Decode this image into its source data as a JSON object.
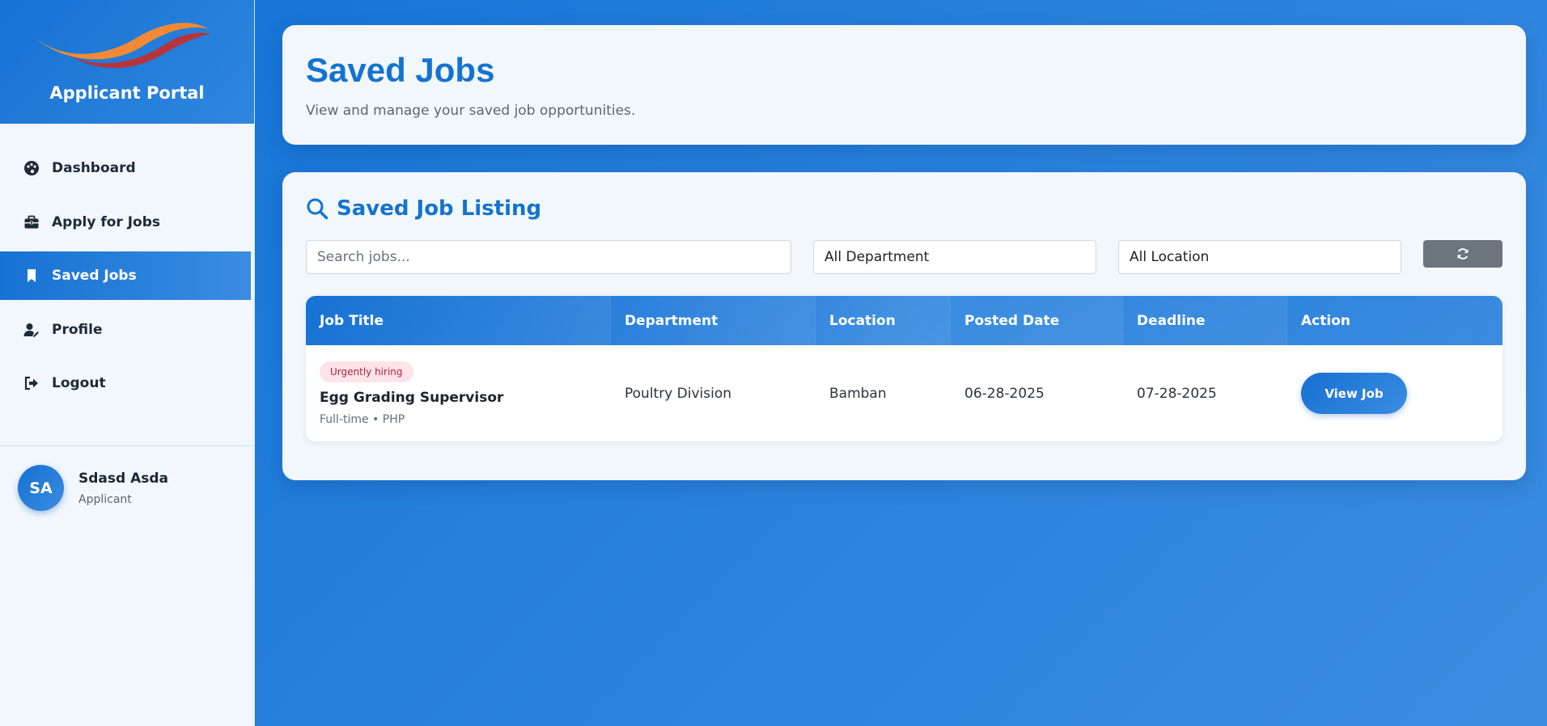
{
  "sidebar": {
    "portal_title": "Applicant Portal",
    "items": [
      {
        "label": "Dashboard",
        "icon": "palette-icon",
        "active": false
      },
      {
        "label": "Apply for Jobs",
        "icon": "briefcase-icon",
        "active": false
      },
      {
        "label": "Saved Jobs",
        "icon": "bookmark-icon",
        "active": true
      },
      {
        "label": "Profile",
        "icon": "user-edit-icon",
        "active": false
      },
      {
        "label": "Logout",
        "icon": "sign-out-icon",
        "active": false
      }
    ],
    "user": {
      "initials": "SA",
      "name": "Sdasd Asda",
      "role": "Applicant"
    }
  },
  "header": {
    "title": "Saved Jobs",
    "subtitle": "View and manage your saved job opportunities."
  },
  "listing": {
    "title": "Saved Job Listing",
    "search_placeholder": "Search jobs...",
    "department_selected": "All Department",
    "location_selected": "All Location",
    "columns": [
      "Job Title",
      "Department",
      "Location",
      "Posted Date",
      "Deadline",
      "Action"
    ],
    "rows": [
      {
        "badge": "Urgently hiring",
        "title": "Egg Grading Supervisor",
        "meta": "Full-time • PHP",
        "department": "Poultry Division",
        "location": "Bamban",
        "posted": "06-28-2025",
        "deadline": "07-28-2025",
        "action": "View Job"
      }
    ]
  },
  "colors": {
    "accent": "#1473d0",
    "badge_bg": "#fde3ea",
    "badge_text": "#b0243d",
    "refresh_bg": "#6c757d"
  }
}
